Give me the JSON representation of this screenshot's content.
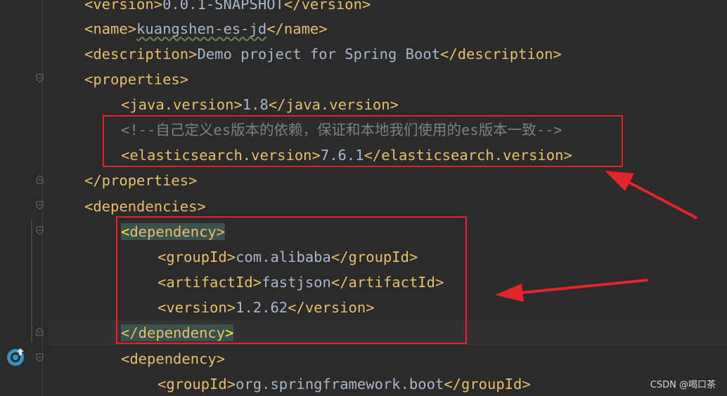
{
  "editor": {
    "lines": [
      {
        "id": "version",
        "open": "<version>",
        "text": "0.0.1-SNAPSHOT",
        "close": "</version>"
      },
      {
        "id": "name",
        "open": "<name>",
        "text": "kuangshen-es-jd",
        "close": "</name>"
      },
      {
        "id": "description",
        "open": "<description>",
        "text": "Demo project for Spring Boot",
        "close": "</description>"
      },
      {
        "id": "properties-open",
        "open": "<properties>"
      },
      {
        "id": "java-version",
        "open": "<java.version>",
        "text": "1.8",
        "close": "</java.version>"
      },
      {
        "id": "comment",
        "comment": "<!--自己定义es版本的依赖，保证和本地我们使用的es版本一致-->"
      },
      {
        "id": "es-version",
        "open": "<elasticsearch.version>",
        "text": "7.6.1",
        "close": "</elasticsearch.version>"
      },
      {
        "id": "properties-close",
        "open": "</properties>"
      },
      {
        "id": "dependencies-open",
        "open": "<dependencies>"
      },
      {
        "id": "dependency-open",
        "open_lt": "<",
        "open_rest": "dependency>"
      },
      {
        "id": "groupid-alibaba",
        "open": "<groupId>",
        "text": "com.alibaba",
        "close": "</groupId>"
      },
      {
        "id": "artifactid-fastjson",
        "open": "<artifactId>",
        "text": "fastjson",
        "close": "</artifactId>"
      },
      {
        "id": "fastjson-version",
        "open": "<version>",
        "text": "1.2.62",
        "close": "</version>"
      },
      {
        "id": "dependency-close",
        "close_rest": "</dependency",
        "close_gt": ">"
      },
      {
        "id": "dependency2-open",
        "open": "<dependency>"
      },
      {
        "id": "groupid-spring",
        "open": "<groupId>",
        "text": "org.springframework.boot",
        "close": "</groupId>"
      }
    ]
  },
  "watermark": "CSDN @喝口茶",
  "icons": {
    "fold": "fold-marker-icon",
    "deploy": "deploy-icon"
  },
  "colors": {
    "background": "#2b2b2b",
    "tag": "#e8bf6a",
    "text": "#a9b7c6",
    "comment": "#808080",
    "annotation": "#e3242b"
  }
}
